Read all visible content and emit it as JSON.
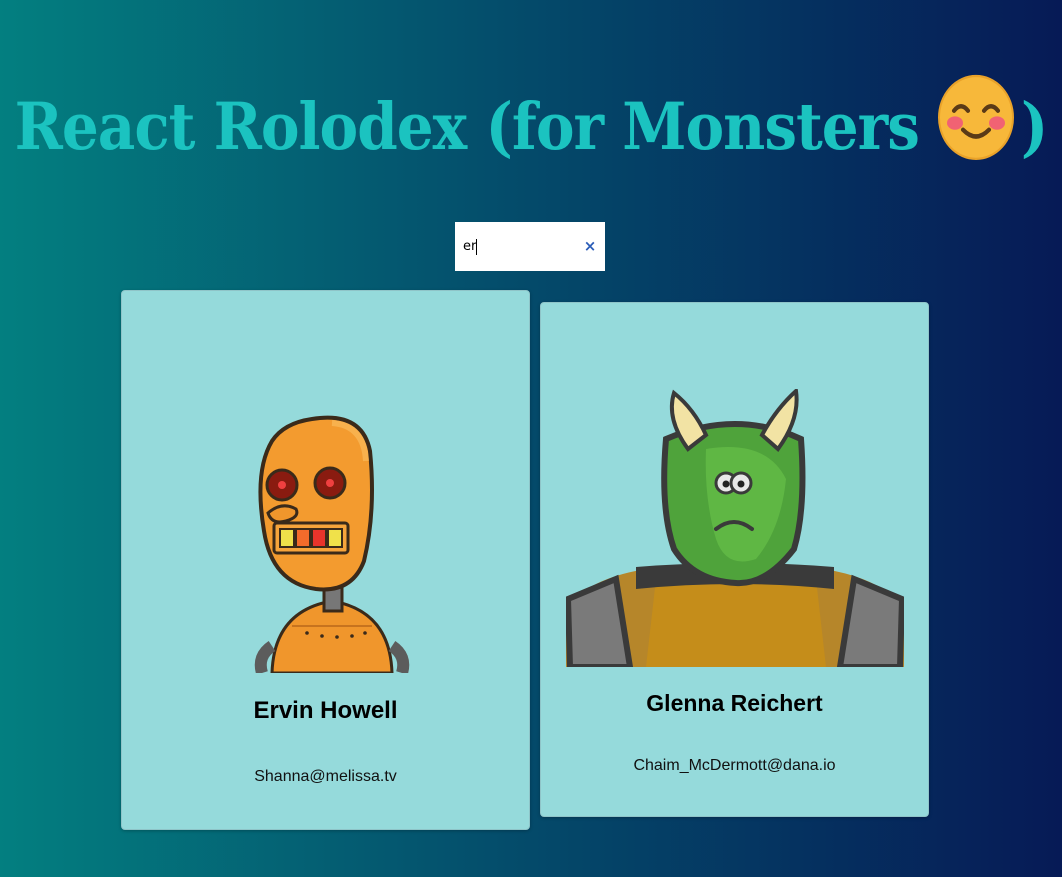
{
  "header": {
    "title_prefix": "React Rolodex (for Monsters",
    "title_suffix": ")",
    "emoji": "smiling-face-icon"
  },
  "search": {
    "value": "er",
    "clear_icon": "×"
  },
  "cards": [
    {
      "name": "Ervin Howell",
      "email": "Shanna@melissa.tv",
      "avatar": "orange-robot-avatar"
    },
    {
      "name": "Glenna Reichert",
      "email": "Chaim_McDermott@dana.io",
      "avatar": "green-horned-monster-avatar"
    }
  ],
  "colors": {
    "title": "#1bc3c0",
    "card_background": "#95dadb",
    "gradient_start": "#037f80",
    "gradient_end": "#061a56",
    "clear_icon": "#2b5db8"
  }
}
